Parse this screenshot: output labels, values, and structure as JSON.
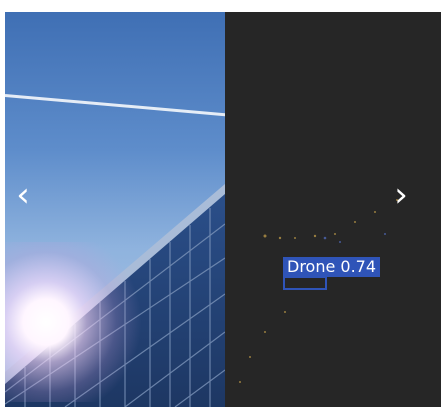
{
  "viewer": {
    "prev_icon": "chevron-left-icon",
    "next_icon": "chevron-right-icon",
    "prev_glyph": "‹",
    "next_glyph": "›"
  },
  "detection": {
    "label": "Drone 0.74",
    "color": "#2f54b8"
  },
  "colors": {
    "sky_top": "#3f6fb4",
    "sky_bottom": "#b6cbe6",
    "dark_pane": "#262626"
  }
}
